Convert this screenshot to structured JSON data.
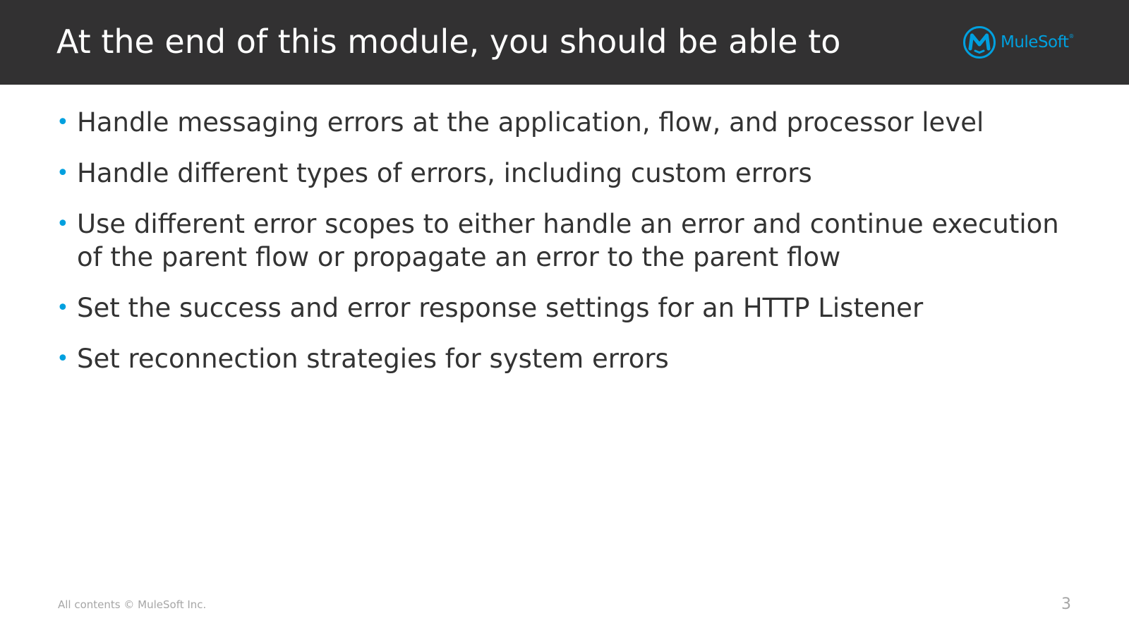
{
  "slide": {
    "title": "At the end of this module, you should be able to",
    "logo": {
      "text": "MuleSoft",
      "registered_mark": "®",
      "icon": "mulesoft-m-icon",
      "color": "#00a0df"
    },
    "bullet_color": "#00a0df",
    "bullets": [
      "Handle messaging errors at the application, flow, and processor level",
      "Handle different types of errors, including custom errors",
      "Use different error scopes to either handle an error and continue execution of the parent flow or propagate an error to the parent flow",
      "Set the success and error response settings for an HTTP Listener",
      "Set reconnection strategies for system errors"
    ],
    "footer": {
      "copyright": "All contents © MuleSoft Inc.",
      "page_number": "3"
    }
  }
}
